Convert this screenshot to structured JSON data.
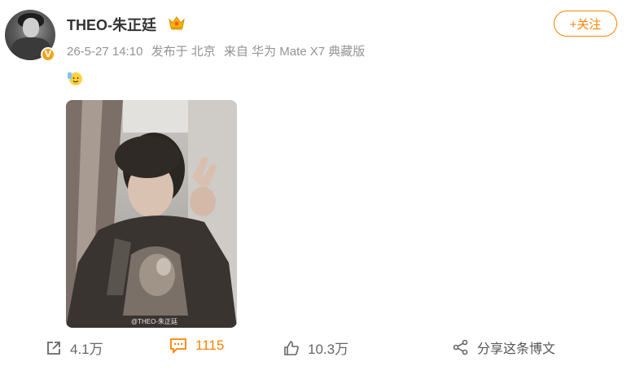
{
  "post": {
    "username": "THEO-朱正廷",
    "time": "26-5-27 14:10",
    "location": "发布于 北京",
    "source": "来自 华为 Mate X7 典藏版",
    "follow_label": "+关注",
    "image_watermark": "@THEO-朱正廷"
  },
  "actions": {
    "repost": "4.1万",
    "comments": "1115",
    "likes": "10.3万",
    "share_label": "分享这条博文"
  },
  "icons": {
    "badge": "verified-v-icon",
    "crown": "crown-icon",
    "emoji": "waving-emoji-icon",
    "repost": "repost-icon",
    "comment": "comment-icon",
    "like": "thumbs-up-icon",
    "share": "share-icon"
  },
  "colors": {
    "accent": "#ff8200",
    "meta_gray": "#939393",
    "badge": "#f7a21b"
  }
}
